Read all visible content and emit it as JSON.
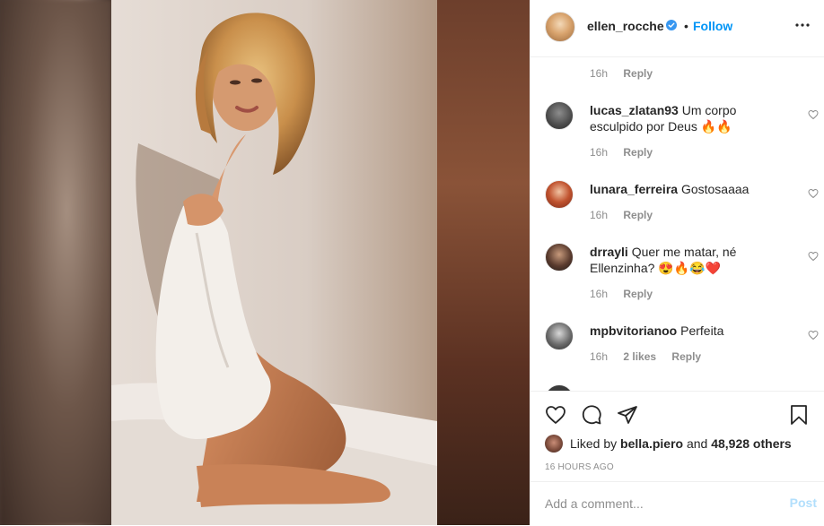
{
  "header": {
    "username": "ellen_rocche",
    "separator": "•",
    "follow_label": "Follow"
  },
  "comments": {
    "partial_top": {
      "time": "16h",
      "reply": "Reply"
    },
    "items": [
      {
        "username": "lucas_zlatan93",
        "text": "Um corpo esculpido por Deus 🔥🔥",
        "time": "16h",
        "likes": "",
        "reply": "Reply"
      },
      {
        "username": "lunara_ferreira",
        "text": "Gostosaaaa",
        "time": "16h",
        "likes": "",
        "reply": "Reply"
      },
      {
        "username": "drrayli",
        "text": "Quer me matar, né Ellenzinha? 😍🔥😂❤️",
        "time": "16h",
        "likes": "",
        "reply": "Reply"
      },
      {
        "username": "mpbvitorianoo",
        "text": "Perfeita",
        "time": "16h",
        "likes": "2 likes",
        "reply": "Reply"
      }
    ]
  },
  "actions": {
    "liked_prefix": "Liked by",
    "liked_user": "bella.piero",
    "liked_and": "and",
    "liked_count": "48,928 others",
    "timestamp": "16 HOURS AGO",
    "comment_placeholder": "Add a comment...",
    "post_label": "Post"
  },
  "colors": {
    "follow": "#0095f6",
    "post_disabled": "#b2dffc",
    "muted": "#8e8e8e",
    "verified": "#3897f0"
  },
  "icons": [
    "heart-icon",
    "comment-icon",
    "share-icon",
    "bookmark-icon",
    "more-icon",
    "verified-icon"
  ]
}
